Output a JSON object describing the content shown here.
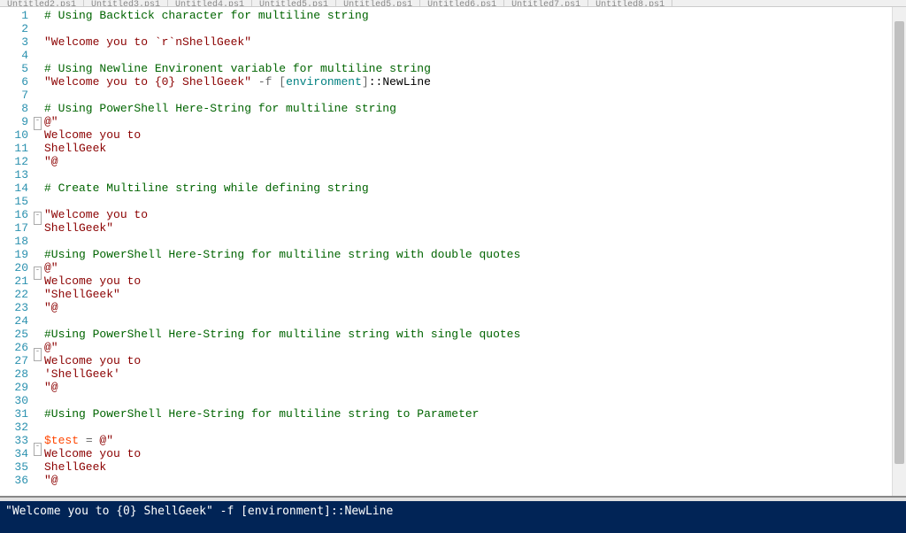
{
  "tabs": [
    "Untitled2.ps1",
    "Untitled3.ps1",
    "Untitled4.ps1",
    "Untitled5.ps1",
    "Untitled5.ps1",
    "Untitled6.ps1",
    "Untitled7.ps1",
    "Untitled8.ps1"
  ],
  "gutter": [
    "1",
    "2",
    "3",
    "4",
    "5",
    "6",
    "7",
    "8",
    "9",
    "10",
    "11",
    "12",
    "13",
    "14",
    "15",
    "16",
    "17",
    "18",
    "19",
    "20",
    "21",
    "22",
    "23",
    "24",
    "25",
    "26",
    "27",
    "28",
    "29",
    "30",
    "31",
    "32",
    "33",
    "34",
    "35",
    "36"
  ],
  "fold": {
    "9": "⊟",
    "16": "⊟",
    "20": "⊟",
    "26": "⊟",
    "33": "⊟"
  },
  "code": {
    "l1": {
      "comment": "# Using Backtick character for multiline string"
    },
    "l2": {
      "blank": ""
    },
    "l3": {
      "string": "\"Welcome you to `r`nShellGeek\""
    },
    "l4": {
      "blank": ""
    },
    "l5": {
      "comment": "# Using Newline Environent variable for multiline string"
    },
    "l6": {
      "string": "\"Welcome you to {0} ShellGeek\"",
      "op": " -f ",
      "type_open": "[",
      "type": "environment",
      "type_close": "]",
      "plain": "::NewLine"
    },
    "l7": {
      "blank": ""
    },
    "l8": {
      "comment": "# Using PowerShell Here-String for multiline string"
    },
    "l9": {
      "string": "@\""
    },
    "l10": {
      "string": "Welcome you to"
    },
    "l11": {
      "string": "ShellGeek"
    },
    "l12": {
      "string": "\"@"
    },
    "l13": {
      "blank": ""
    },
    "l14": {
      "comment": "# Create Multiline string while defining string"
    },
    "l15": {
      "blank": ""
    },
    "l16": {
      "string": "\"Welcome you to"
    },
    "l17": {
      "string": "ShellGeek\""
    },
    "l18": {
      "blank": ""
    },
    "l19": {
      "comment": "#Using PowerShell Here-String for multiline string with double quotes"
    },
    "l20": {
      "string": "@\""
    },
    "l21": {
      "string": "Welcome you to"
    },
    "l22": {
      "string": "\"ShellGeek\""
    },
    "l23": {
      "string": "\"@"
    },
    "l24": {
      "blank": ""
    },
    "l25": {
      "comment": "#Using PowerShell Here-String for multiline string with single quotes"
    },
    "l26": {
      "string": "@\""
    },
    "l27": {
      "string": "Welcome you to"
    },
    "l28": {
      "string": "'ShellGeek'"
    },
    "l29": {
      "string": "\"@"
    },
    "l30": {
      "blank": ""
    },
    "l31": {
      "comment": "#Using PowerShell Here-String for multiline string to Parameter"
    },
    "l32": {
      "blank": ""
    },
    "l33": {
      "var": "$test",
      "op": " = ",
      "string": "@\""
    },
    "l34": {
      "string": "Welcome you to"
    },
    "l35": {
      "string": "ShellGeek"
    },
    "l36": {
      "string": "\"@"
    }
  },
  "console": {
    "line": "\"Welcome you to {0} ShellGeek\" -f [environment]::NewLine"
  }
}
